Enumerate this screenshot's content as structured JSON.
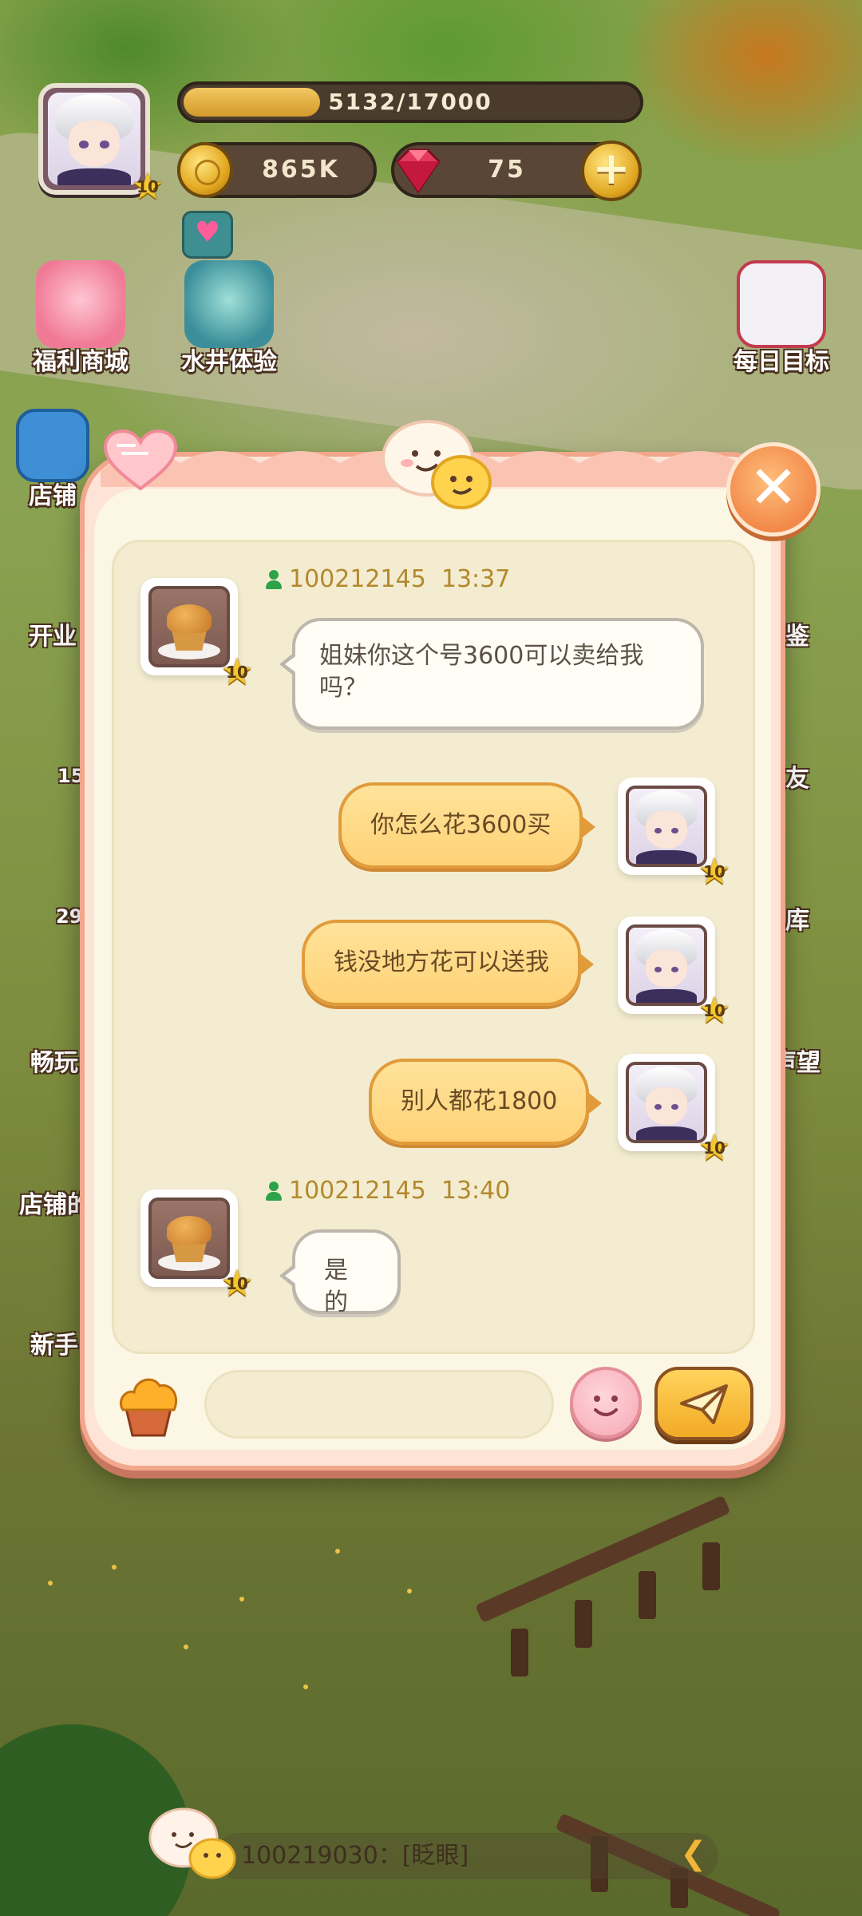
{
  "hud": {
    "player_level": "10",
    "xp_text": "5132/17000",
    "xp_fraction": 0.3019,
    "coins": "865K",
    "gems": "75",
    "plus_icon": "plus-icon"
  },
  "left_buttons": [
    {
      "label": "福利商城"
    },
    {
      "label": "水井体验"
    },
    {
      "label": "店铺"
    },
    {
      "label": "开业"
    },
    {
      "label": "畅玩"
    },
    {
      "label": "店铺的"
    },
    {
      "label": "新手"
    }
  ],
  "left_partial_numbers": [
    "15",
    "29"
  ],
  "right_buttons": [
    {
      "label": "每日目标"
    },
    {
      "label": "鉴"
    },
    {
      "label": "友"
    },
    {
      "label": "库"
    },
    {
      "label": "声望"
    }
  ],
  "chat": {
    "messages": [
      {
        "side": "left",
        "user": "100212145",
        "time": "13:37",
        "level": "10",
        "text": "姐妹你这个号3600可以卖给我吗？"
      },
      {
        "side": "right",
        "level": "10",
        "text": "你怎么花3600买"
      },
      {
        "side": "right",
        "level": "10",
        "text": "钱没地方花可以送我"
      },
      {
        "side": "right",
        "level": "10",
        "text": "别人都花1800"
      },
      {
        "side": "left",
        "user": "100212145",
        "time": "13:40",
        "level": "10",
        "text": "是的"
      }
    ],
    "input_value": ""
  },
  "ticker": {
    "text": "100219030：[眨眼]"
  },
  "colors": {
    "dialog_border": "#f2a68c",
    "bubble_orange": "#ffd277",
    "meta_text": "#b3892d"
  }
}
